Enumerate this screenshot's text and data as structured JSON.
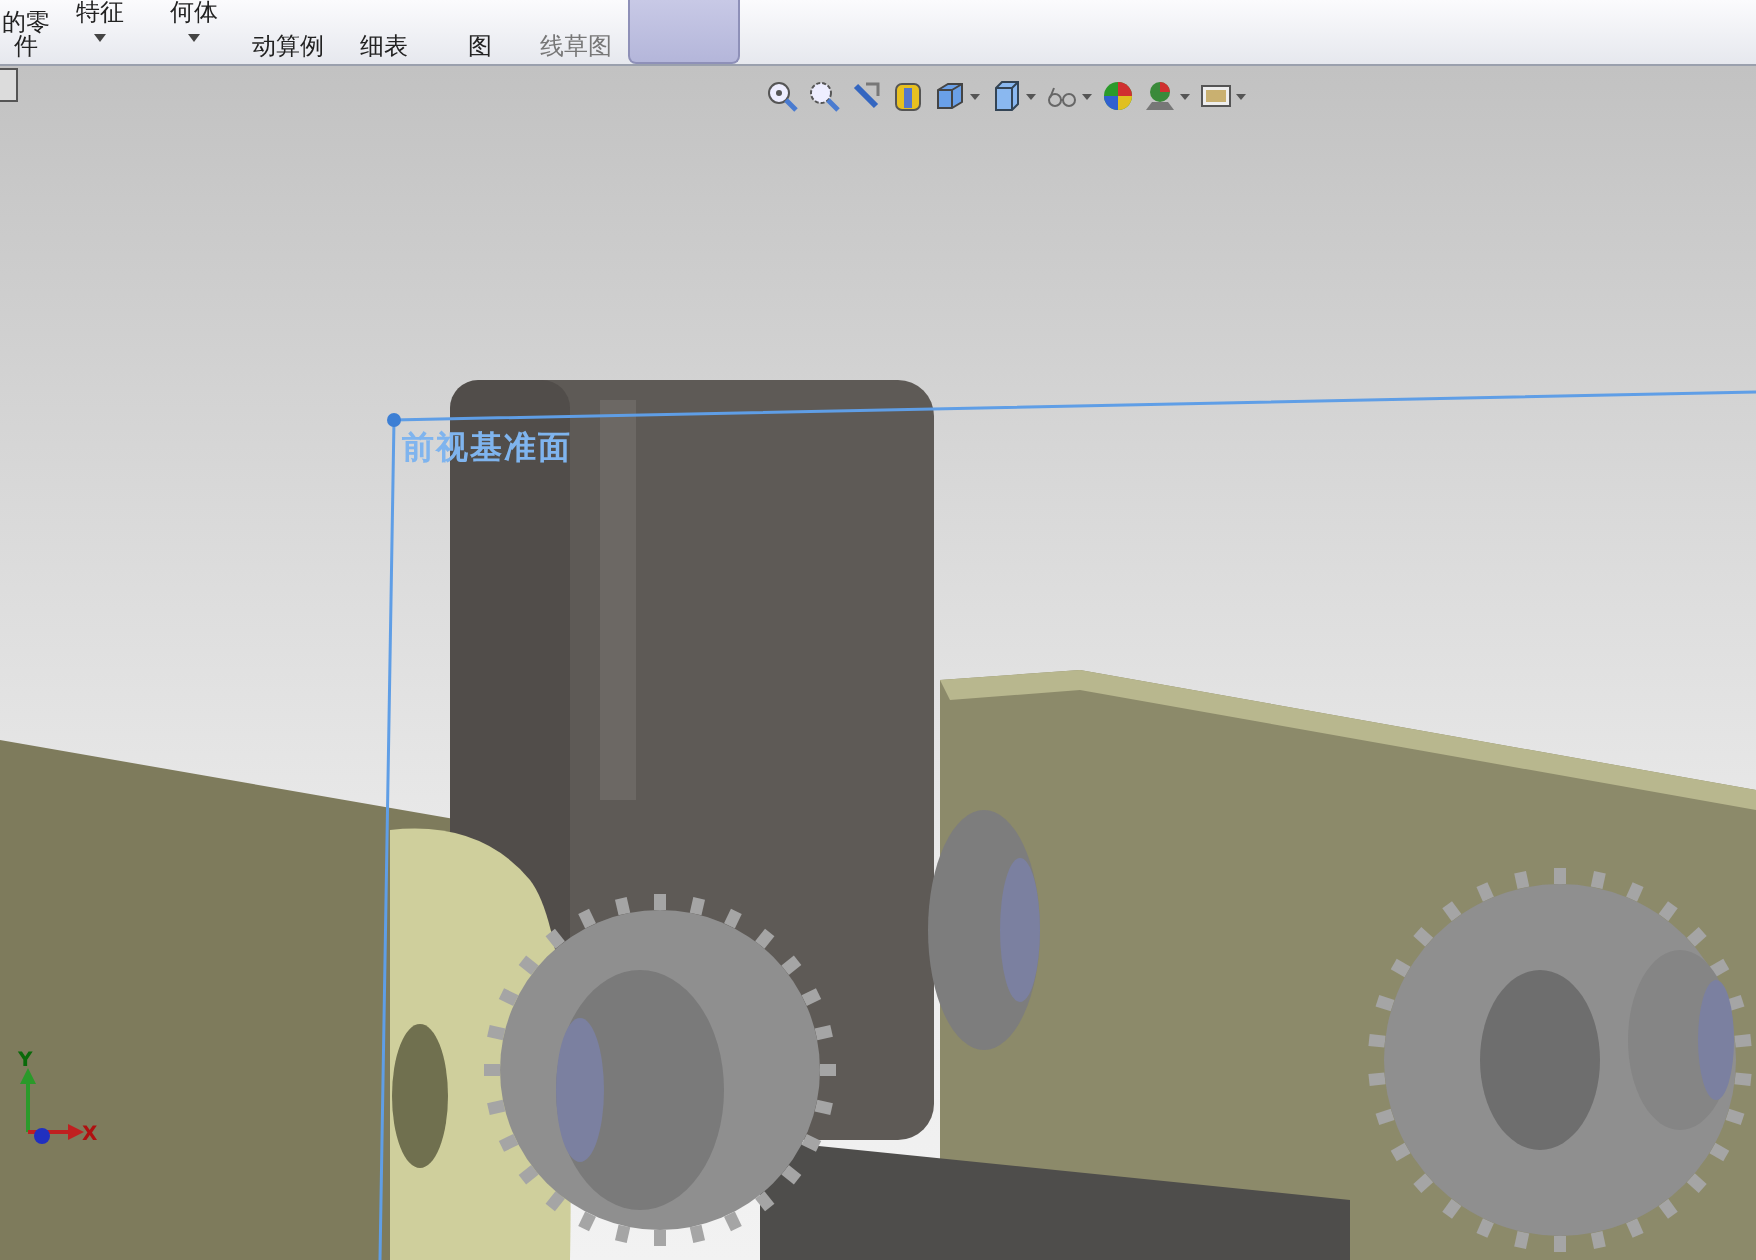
{
  "ribbon": {
    "buttons": [
      {
        "lines": [
          "的零",
          "件"
        ],
        "dropdown": false,
        "selected": false
      },
      {
        "lines": [
          "特征"
        ],
        "dropdown": true,
        "selected": false
      },
      {
        "lines": [
          "何体"
        ],
        "dropdown": true,
        "selected": false
      },
      {
        "lines": [
          "动算例"
        ],
        "dropdown": false,
        "selected": false
      },
      {
        "lines": [
          "细表"
        ],
        "dropdown": false,
        "selected": false
      },
      {
        "lines": [
          "图"
        ],
        "dropdown": false,
        "selected": false
      },
      {
        "lines": [
          "线草图"
        ],
        "dropdown": false,
        "selected": false
      },
      {
        "dropdown": false,
        "selected": true
      }
    ]
  },
  "viewport": {
    "plane_label": "前视基准面",
    "triad": {
      "y_label": "Y",
      "x_label": "X"
    }
  }
}
